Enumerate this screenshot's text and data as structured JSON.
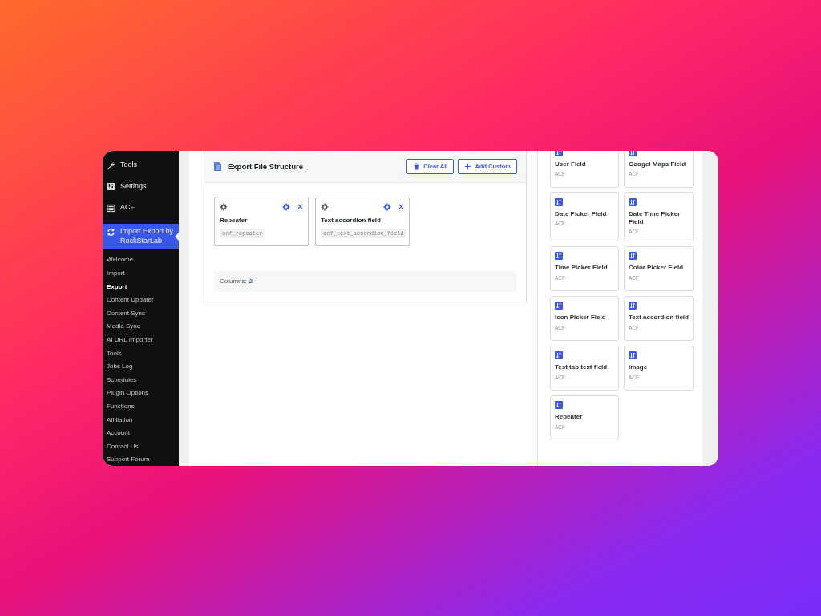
{
  "sidebar": {
    "menu": [
      {
        "label": "Tools",
        "kind": "wrench",
        "selected": false
      },
      {
        "label": "Settings",
        "kind": "settings",
        "selected": false
      },
      {
        "label": "ACF",
        "kind": "grid",
        "selected": false
      },
      {
        "label": "Import Export by RockStarLab",
        "kind": "sync",
        "selected": true
      }
    ],
    "submenu": [
      {
        "label": "Welcome",
        "selected": false
      },
      {
        "label": "Import",
        "selected": false
      },
      {
        "label": "Export",
        "selected": true
      },
      {
        "label": "Content Updater",
        "selected": false
      },
      {
        "label": "Content Sync",
        "selected": false
      },
      {
        "label": "Media Sync",
        "selected": false
      },
      {
        "label": "AI URL Importer",
        "selected": false
      },
      {
        "label": "Tools",
        "selected": false
      },
      {
        "label": "Jobs Log",
        "selected": false
      },
      {
        "label": "Schedules",
        "selected": false
      },
      {
        "label": "Plugin Options",
        "selected": false
      },
      {
        "label": "Functions",
        "selected": false
      },
      {
        "label": "Affiliation",
        "selected": false
      },
      {
        "label": "Account",
        "selected": false
      },
      {
        "label": "Contact Us",
        "selected": false
      },
      {
        "label": "Support Forum",
        "selected": false
      }
    ]
  },
  "export_structure": {
    "title": "Export File Structure",
    "buttons": [
      {
        "label": "Clear All",
        "kind": "trash"
      },
      {
        "label": "Add Custom",
        "kind": "plus"
      }
    ],
    "items": [
      {
        "title": "Repeater",
        "key": "acf_repeater"
      },
      {
        "title": "Text accordion field",
        "key": "acf_text_accordion_field"
      }
    ],
    "columns_label": "Columns:",
    "columns_value": "2"
  },
  "fields": [
    {
      "title": "User Field",
      "source": "ACF"
    },
    {
      "title": "Googel Maps Field",
      "source": "ACF"
    },
    {
      "title": "Date Picker Field",
      "source": "ACF"
    },
    {
      "title": "Date Time Picker Field",
      "source": "ACF"
    },
    {
      "title": "Time Picker Field",
      "source": "ACF"
    },
    {
      "title": "Color Picker Field",
      "source": "ACF"
    },
    {
      "title": "Icon Picker Field",
      "source": "ACF"
    },
    {
      "title": "Text accordion field",
      "source": "ACF"
    },
    {
      "title": "Test tab text field",
      "source": "ACF"
    },
    {
      "title": "Image",
      "source": "ACF"
    },
    {
      "title": "Repeater",
      "source": "ACF"
    }
  ]
}
